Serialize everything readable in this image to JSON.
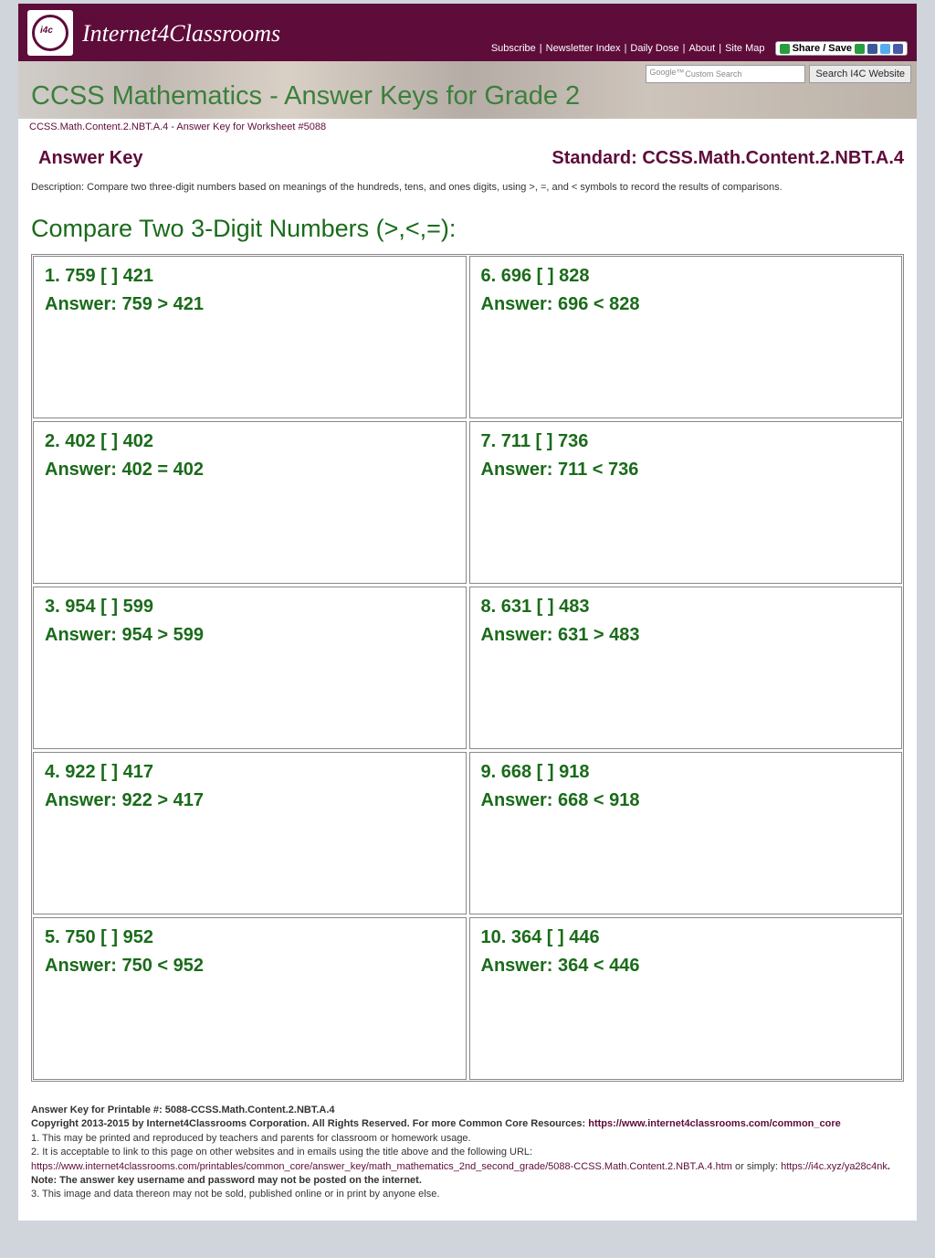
{
  "header": {
    "site_name": "Internet4Classrooms",
    "links": {
      "subscribe": "Subscribe",
      "newsletter": "Newsletter Index",
      "daily": "Daily Dose",
      "about": "About",
      "sitemap": "Site Map"
    },
    "share_label": "Share / Save"
  },
  "search": {
    "placeholder": "Custom Search",
    "button": "Search I4C Website"
  },
  "page_title": "CCSS Mathematics - Answer Keys for Grade 2",
  "breadcrumb": "CCSS.Math.Content.2.NBT.A.4 - Answer Key for Worksheet #5088",
  "answer_key_label": "Answer Key",
  "standard_label": "Standard: CCSS.Math.Content.2.NBT.A.4",
  "description": "Description: Compare two three-digit numbers based on meanings of the hundreds, tens, and ones digits, using >, =, and < symbols to record the results of comparisons.",
  "section_heading": "Compare Two 3-Digit Numbers (>,<,=):",
  "problems": [
    {
      "n": "1",
      "q": "1. 759 [   ] 421",
      "a": "Answer: 759 > 421"
    },
    {
      "n": "2",
      "q": "2. 402 [   ] 402",
      "a": "Answer: 402 = 402"
    },
    {
      "n": "3",
      "q": "3. 954 [   ] 599",
      "a": "Answer: 954 > 599"
    },
    {
      "n": "4",
      "q": "4. 922 [   ] 417",
      "a": "Answer: 922 > 417"
    },
    {
      "n": "5",
      "q": "5. 750 [   ] 952",
      "a": "Answer: 750 < 952"
    },
    {
      "n": "6",
      "q": "6. 696 [   ] 828",
      "a": "Answer: 696 < 828"
    },
    {
      "n": "7",
      "q": "7. 711 [   ] 736",
      "a": "Answer: 711 < 736"
    },
    {
      "n": "8",
      "q": "8. 631 [   ] 483",
      "a": "Answer: 631 > 483"
    },
    {
      "n": "9",
      "q": "9. 668 [   ] 918",
      "a": "Answer: 668 < 918"
    },
    {
      "n": "10",
      "q": "10. 364 [   ] 446",
      "a": "Answer: 364 < 446"
    }
  ],
  "footer": {
    "l1_a": "Answer Key for Printable #: 5088-CCSS.Math.Content.2.NBT.A.4",
    "l2_a": "Copyright 2013-2015 by Internet4Classrooms Corporation. All Rights Reserved. For more Common Core Resources: ",
    "l2_link": "https://www.internet4classrooms.com/common_core",
    "l3": "1. This may be printed and reproduced by teachers and parents for classroom or homework usage.",
    "l4": "2. It is acceptable to link to this page on other websites and in emails using the title above and the following URL:",
    "l5_link1": "https://www.internet4classrooms.com/printables/common_core/answer_key/math_mathematics_2nd_second_grade/5088-CCSS.Math.Content.2.NBT.A.4.htm",
    "l5_mid": " or simply: ",
    "l5_link2": "https://i4c.xyz/ya28c4nk",
    "l5_end": ". Note: The answer key username and password may not be posted on the internet.",
    "l6": "3. This image and data thereon may not be sold, published online or in print by anyone else."
  }
}
